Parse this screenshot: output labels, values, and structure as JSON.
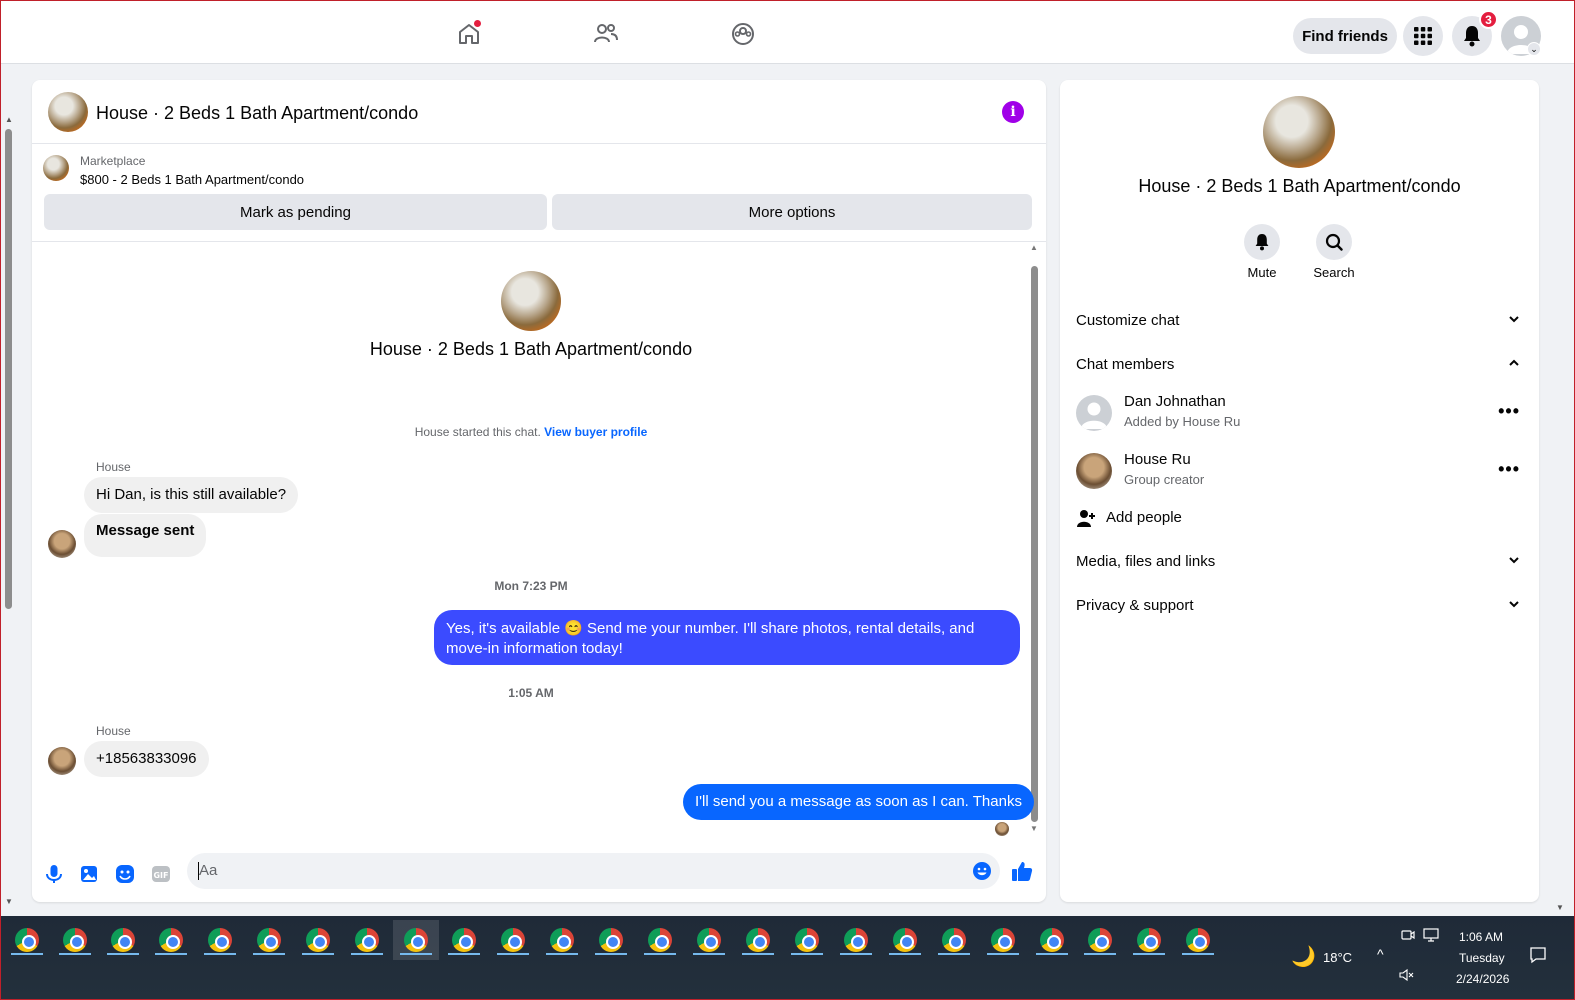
{
  "topnav": {
    "find_friends": "Find friends",
    "notifications_count": "3"
  },
  "chat": {
    "title": "House · 2 Beds 1 Bath Apartment/condo",
    "marketplace_label": "Marketplace",
    "listing": "$800 - 2 Beds 1 Bath Apartment/condo",
    "mark_pending": "Mark as pending",
    "more_options": "More options",
    "center_title": "House · 2 Beds 1 Bath Apartment/condo",
    "started_text": "House started this chat. ",
    "view_buyer": "View buyer profile",
    "sender1": "House",
    "msg1": "Hi Dan, is this still available?",
    "msg2": "Message sent",
    "ts1": "Mon 7:23 PM",
    "msg3": "Yes, it's available 😊 Send me your number. I'll share photos, rental details, and move-in information today!",
    "ts2": "1:05 AM",
    "sender2": "House",
    "msg4": "+18563833096",
    "msg5": "I'll send you a message as soon as I can. Thanks",
    "input_placeholder": "Aa"
  },
  "info": {
    "title": "House · 2 Beds 1 Bath Apartment/condo",
    "mute": "Mute",
    "search": "Search",
    "customize": "Customize chat",
    "members_header": "Chat members",
    "members": [
      {
        "name": "Dan Johnathan",
        "sub": "Added by House Ru"
      },
      {
        "name": "House Ru",
        "sub": "Group creator"
      }
    ],
    "add_people": "Add people",
    "media": "Media, files and links",
    "privacy": "Privacy & support"
  },
  "taskbar": {
    "weather": "18°C",
    "time": "1:06 AM",
    "day": "Tuesday",
    "date": "2/24/2026"
  },
  "colors": {
    "accent": "#0866ff",
    "outgoing_alt": "#3b4bff",
    "info_icon": "#a000e8",
    "badge": "#e41e3f"
  }
}
